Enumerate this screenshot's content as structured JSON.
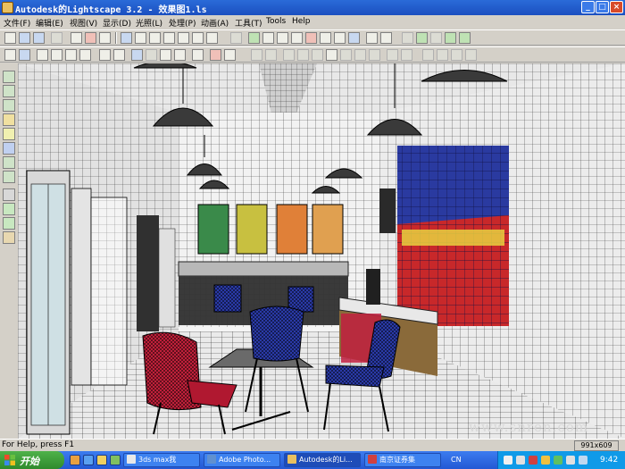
{
  "window": {
    "title": "Autodesk的Lightscape 3.2  - 效果图1.ls",
    "controls": [
      "_",
      "□",
      "×"
    ]
  },
  "menu": [
    {
      "label": "文件(F)"
    },
    {
      "label": "编辑(E)"
    },
    {
      "label": "视图(V)"
    },
    {
      "label": "显示(D)"
    },
    {
      "label": "光照(L)"
    },
    {
      "label": "处理(P)"
    },
    {
      "label": "动画(A)"
    },
    {
      "label": "工具(T)"
    },
    {
      "label": "Tools"
    },
    {
      "label": "Help"
    }
  ],
  "viewport": {
    "watermark": "www.snren.com",
    "colors": {
      "banner_blue": "#2a3aa0",
      "banner_red": "#c8282a",
      "chair_red": "#c0203a",
      "chair_blue": "#2a3aa8"
    }
  },
  "status": {
    "help": "For Help, press F1",
    "size": "991x609"
  },
  "taskbar": {
    "start_label": "开始",
    "tasks": [
      {
        "label": "3ds max我"
      },
      {
        "label": "Adobe Photo..."
      },
      {
        "label": "Autodesk的Li..."
      },
      {
        "label": "南京证券集"
      }
    ],
    "lang": "CN",
    "clock": "9:42"
  }
}
